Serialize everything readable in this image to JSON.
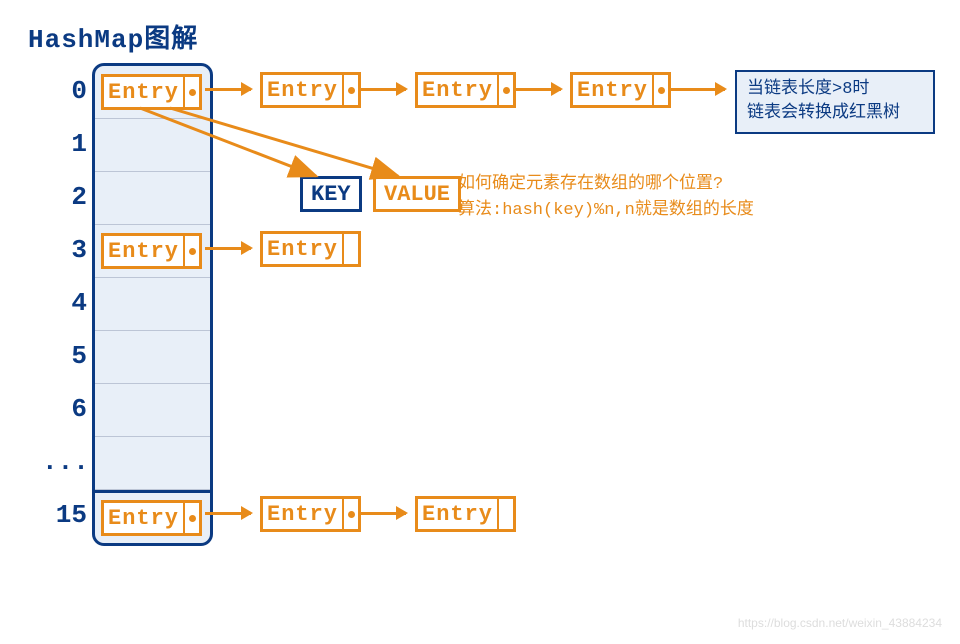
{
  "title": "HashMap图解",
  "indices": [
    "0",
    "1",
    "2",
    "3",
    "4",
    "5",
    "6",
    "...",
    "15"
  ],
  "entry_label": "Entry",
  "key_label": "KEY",
  "value_label": "VALUE",
  "tree_note_line1": "当链表长度>8时",
  "tree_note_line2": "链表会转换成红黑树",
  "hash_note_line1": "如何确定元素存在数组的哪个位置?",
  "hash_note_line2": "算法:hash(key)%n,n就是数组的长度",
  "watermark": "https://blog.csdn.net/weixin_43884234"
}
